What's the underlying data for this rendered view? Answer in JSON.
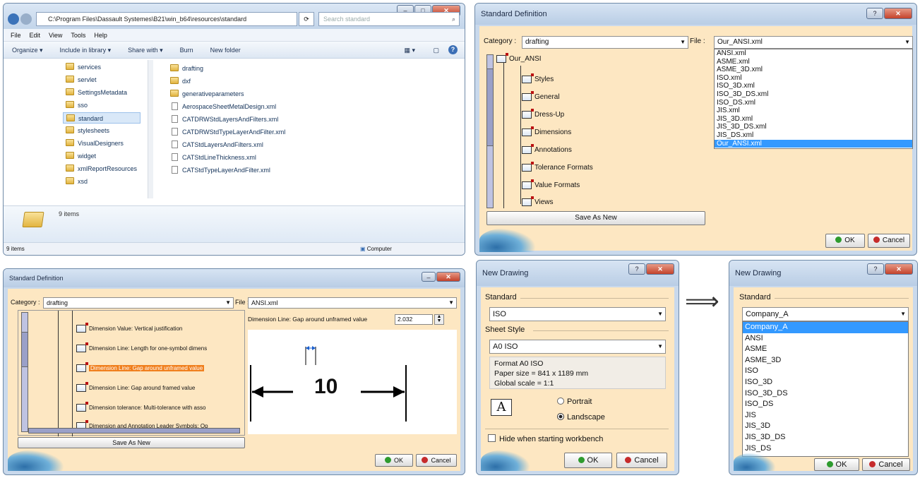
{
  "explorer": {
    "address": "C:\\Program Files\\Dassault Systemes\\B21\\win_b64\\resources\\standard",
    "search_placeholder": "Search standard",
    "menu": [
      "File",
      "Edit",
      "View",
      "Tools",
      "Help"
    ],
    "toolbar": [
      "Organize ▾",
      "Include in library ▾",
      "Share with ▾",
      "Burn",
      "New folder"
    ],
    "nav_items": [
      "services",
      "servlet",
      "SettingsMetadata",
      "sso",
      "standard",
      "stylesheets",
      "VisualDesigners",
      "widget",
      "xmlReportResources",
      "xsd"
    ],
    "folders": [
      "drafting",
      "dxf",
      "generativeparameters"
    ],
    "files": [
      "AerospaceSheetMetalDesign.xml",
      "CATDRWStdLayersAndFilters.xml",
      "CATDRWStdTypeLayerAndFilter.xml",
      "CATStdLayersAndFilters.xml",
      "CATStdLineThickness.xml",
      "CATStdTypeLayerAndFilter.xml"
    ],
    "details_count": "9 items",
    "status_left": "9 items",
    "status_right": "Computer"
  },
  "std_def_top": {
    "title": "Standard Definition",
    "category_label": "Category :",
    "category_value": "drafting",
    "file_label": "File :",
    "file_value": "Our_ANSI.xml",
    "tree_root": "Our_ANSI",
    "tree_items": [
      "Styles",
      "General",
      "Dress-Up",
      "Dimensions",
      "Annotations",
      "Tolerance Formats",
      "Value Formats",
      "Views"
    ],
    "file_options": [
      "ANSI.xml",
      "ASME.xml",
      "ASME_3D.xml",
      "ISO.xml",
      "ISO_3D.xml",
      "ISO_3D_DS.xml",
      "ISO_DS.xml",
      "JIS.xml",
      "JIS_3D.xml",
      "JIS_3D_DS.xml",
      "JIS_DS.xml",
      "Our_ANSI.xml"
    ],
    "save_as_new": "Save As New",
    "ok": "OK",
    "cancel": "Cancel"
  },
  "std_def_bottom": {
    "title": "Standard Definition",
    "category_label": "Category :",
    "category_value": "drafting",
    "file_label": "File :",
    "file_value": "ANSI.xml",
    "tree_items": [
      "Dimension Value: Vertical justification",
      "Dimension Line: Length for one-symbol dimens",
      "Dimension Line: Gap around unframed value",
      "Dimension Line: Gap around framed value",
      "Dimension tolerance: Multi-tolerance with asso",
      "Dimension and Annotation Leader Symbols: Op"
    ],
    "param_label": "Dimension Line: Gap around unframed value",
    "param_value": "2.032",
    "preview_value": "10",
    "save_as_new": "Save As New",
    "ok": "OK",
    "cancel": "Cancel"
  },
  "new_drawing_left": {
    "title": "New Drawing",
    "standard_label": "Standard",
    "standard_value": "ISO",
    "sheet_style_label": "Sheet Style",
    "sheet_style_value": "A0 ISO",
    "info_lines": [
      "Format A0 ISO",
      "Paper size = 841 x 1189 mm",
      "Global scale = 1:1"
    ],
    "portrait": "Portrait",
    "landscape": "Landscape",
    "hide_label": "Hide when starting workbench",
    "ok": "OK",
    "cancel": "Cancel"
  },
  "arrow": "⟹",
  "new_drawing_right": {
    "title": "New Drawing",
    "standard_label": "Standard",
    "standard_value": "Company_A",
    "options": [
      "Company_A",
      "ANSI",
      "ASME",
      "ASME_3D",
      "ISO",
      "ISO_3D",
      "ISO_3D_DS",
      "ISO_DS",
      "JIS",
      "JIS_3D",
      "JIS_3D_DS",
      "JIS_DS"
    ],
    "ok": "OK",
    "cancel": "Cancel"
  }
}
